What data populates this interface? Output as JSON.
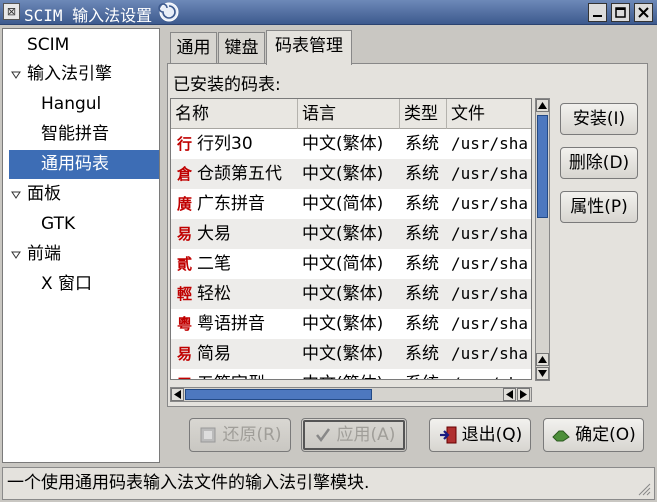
{
  "window": {
    "title": "SCIM 输入法设置"
  },
  "tree": {
    "items": [
      {
        "label": "SCIM",
        "level": 0,
        "expanded": null,
        "selected": false
      },
      {
        "label": "输入法引擎",
        "level": 0,
        "expanded": true,
        "selected": false
      },
      {
        "label": "Hangul",
        "level": 1,
        "expanded": null,
        "selected": false
      },
      {
        "label": "智能拼音",
        "level": 1,
        "expanded": null,
        "selected": false
      },
      {
        "label": "通用码表",
        "level": 1,
        "expanded": null,
        "selected": true
      },
      {
        "label": "面板",
        "level": 0,
        "expanded": true,
        "selected": false
      },
      {
        "label": "GTK",
        "level": 1,
        "expanded": null,
        "selected": false
      },
      {
        "label": "前端",
        "level": 0,
        "expanded": true,
        "selected": false
      },
      {
        "label": "X 窗口",
        "level": 1,
        "expanded": null,
        "selected": false
      }
    ]
  },
  "tabs": [
    {
      "label": "通用",
      "active": false
    },
    {
      "label": "键盘",
      "active": false
    },
    {
      "label": "码表管理",
      "active": true
    }
  ],
  "installed_label": "已安装的码表:",
  "table": {
    "columns": [
      "名称",
      "语言",
      "类型",
      "文件"
    ],
    "rows": [
      {
        "glyph": "行",
        "name": "行列30",
        "lang": "中文(繁体)",
        "type": "系统",
        "file": "/usr/sha"
      },
      {
        "glyph": "倉",
        "name": "仓颉第五代",
        "lang": "中文(繁体)",
        "type": "系统",
        "file": "/usr/sha"
      },
      {
        "glyph": "廣",
        "name": "广东拼音",
        "lang": "中文(简体)",
        "type": "系统",
        "file": "/usr/sha"
      },
      {
        "glyph": "易",
        "name": "大易",
        "lang": "中文(繁体)",
        "type": "系统",
        "file": "/usr/sha"
      },
      {
        "glyph": "貳",
        "name": "二笔",
        "lang": "中文(简体)",
        "type": "系统",
        "file": "/usr/sha"
      },
      {
        "glyph": "輕",
        "name": "轻松",
        "lang": "中文(繁体)",
        "type": "系统",
        "file": "/usr/sha"
      },
      {
        "glyph": "粵",
        "name": "粤语拼音",
        "lang": "中文(繁体)",
        "type": "系统",
        "file": "/usr/sha"
      },
      {
        "glyph": "易",
        "name": "简易",
        "lang": "中文(繁体)",
        "type": "系统",
        "file": "/usr/sha"
      },
      {
        "glyph": "五",
        "name": "五笔字型",
        "lang": "中文(简体)",
        "type": "系统",
        "file": "/usr/sha"
      }
    ]
  },
  "side_buttons": {
    "install": "安装(I)",
    "delete": "删除(D)",
    "properties": "属性(P)"
  },
  "bottom_buttons": {
    "restore": "还原(R)",
    "apply": "应用(A)",
    "quit": "退出(Q)",
    "ok": "确定(O)"
  },
  "status_text": "一个使用通用码表输入法文件的输入法引擎模块.",
  "colors": {
    "titlebar": "#3d5a8e",
    "selection": "#3d6db5",
    "glyph": "#c00000",
    "scroll_thumb": "#4d78bf"
  },
  "icons": {
    "window_menu": "window-menu-icon",
    "title_swirl": "swirl-icon",
    "minimize": "minimize-icon",
    "maximize": "maximize-icon",
    "close": "close-icon",
    "restore": "revert-icon",
    "apply": "checkmark-icon",
    "quit": "exit-icon",
    "ok": "ok-hand-icon"
  }
}
